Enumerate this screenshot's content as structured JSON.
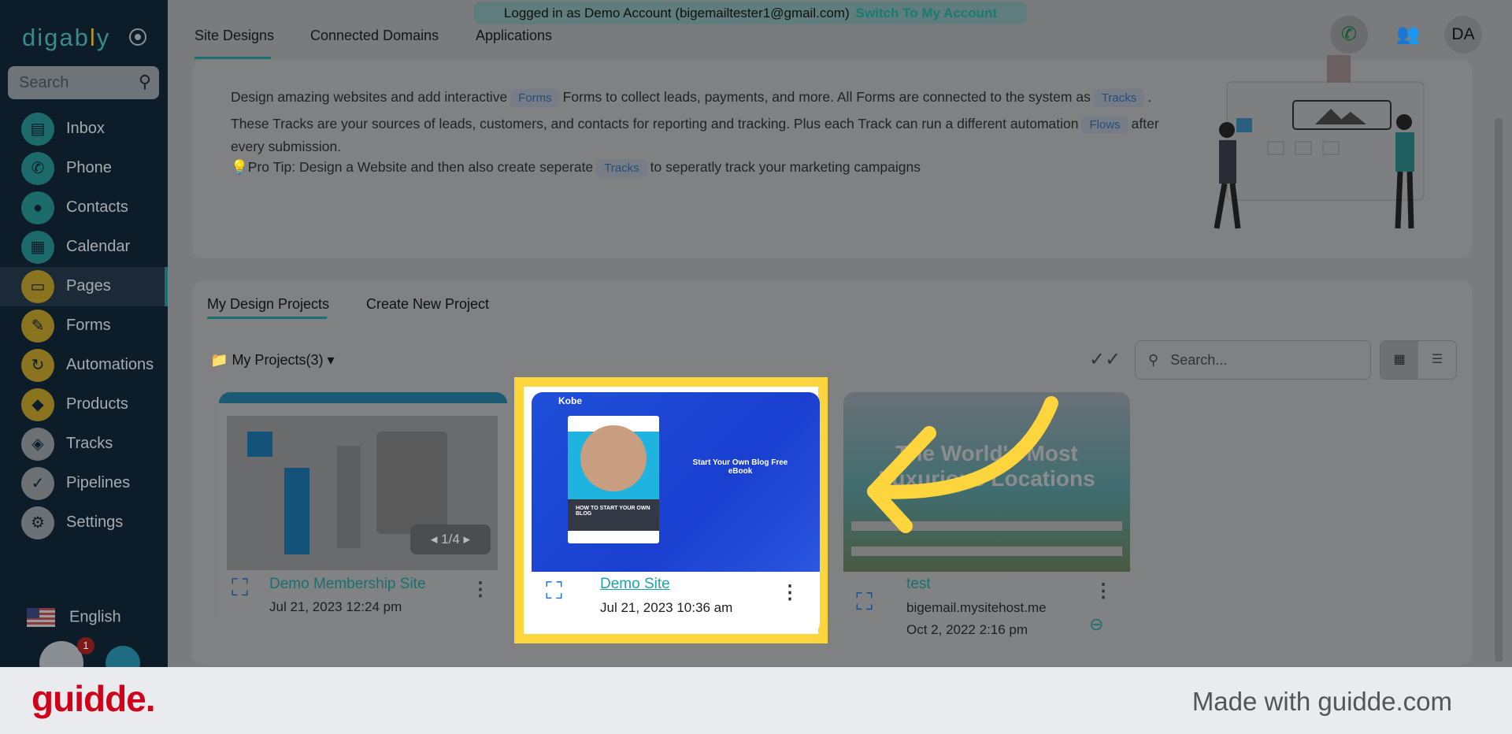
{
  "sidebar": {
    "logo": "digably",
    "search_placeholder": "Search",
    "items": [
      {
        "label": "Inbox",
        "icon": "inbox-icon"
      },
      {
        "label": "Phone",
        "icon": "phone-icon"
      },
      {
        "label": "Contacts",
        "icon": "contacts-icon"
      },
      {
        "label": "Calendar",
        "icon": "calendar-icon"
      },
      {
        "label": "Pages",
        "icon": "pages-icon"
      },
      {
        "label": "Forms",
        "icon": "forms-icon"
      },
      {
        "label": "Automations",
        "icon": "automations-icon"
      },
      {
        "label": "Products",
        "icon": "products-icon"
      },
      {
        "label": "Tracks",
        "icon": "tracks-icon"
      },
      {
        "label": "Pipelines",
        "icon": "pipelines-icon"
      },
      {
        "label": "Settings",
        "icon": "settings-icon"
      }
    ],
    "language": "English",
    "notification_count": "1"
  },
  "banner": {
    "text": "Logged in as Demo Account (bigemailtester1@gmail.com)",
    "switch": "Switch To My Account"
  },
  "tabs": [
    "Site Designs",
    "Connected Domains",
    "Applications"
  ],
  "header": {
    "avatar": "DA"
  },
  "intro": {
    "l1a": "Design amazing websites and add interactive",
    "forms": "Forms",
    "l1b": "Forms to collect leads, payments, and more. All Forms are connected to the system as",
    "tracks": "Tracks",
    "l2a": "These Tracks are your sources of leads, customers, and contacts for reporting and tracking. Plus each Track can run a different automation",
    "flows": "Flows",
    "l2b": "after",
    "l3": "every submission.",
    "tip_a": "Pro Tip: Design a Website and then also create seperate",
    "tip_b": "to seperatly track your marketing campaigns"
  },
  "projects": {
    "tabs": [
      "My Design Projects",
      "Create New Project"
    ],
    "folder": "My Projects(3)",
    "search_placeholder": "Search...",
    "cards": [
      {
        "title": "Demo Membership Site",
        "date": "Jul 21, 2023 12:24 pm",
        "carousel": "1/4"
      },
      {
        "title": "Demo Site",
        "date": "Jul 21, 2023 10:36 am",
        "thumb_brand": "Kobe",
        "thumb_heading": "Start Your Own Blog Free eBook",
        "thumb_book": "HOW TO START YOUR OWN BLOG"
      },
      {
        "title": "test",
        "domain": "bigemail.mysitehost.me",
        "date": "Oct 2, 2022 2:16 pm",
        "thumb_heading": "The World's Most Luxurious Locations"
      }
    ]
  },
  "footer": {
    "brand": "guidde.",
    "made": "Made with guidde.com"
  },
  "colors": {
    "highlight": "#ffd53d",
    "teal": "#1c6f6f"
  }
}
